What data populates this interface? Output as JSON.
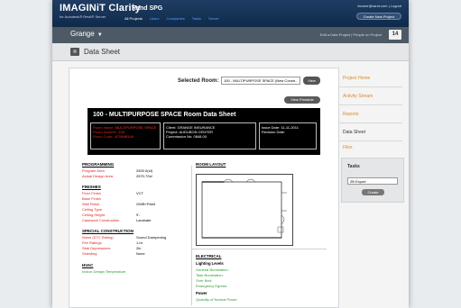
{
  "app": {
    "logo": "IMAGINiT Clarity",
    "logo_sub": "for Autodesk® Revit® Server",
    "project_name": "Rand SPG",
    "nav": [
      "All Projects",
      "Users",
      "Companies",
      "Tasks",
      "Server"
    ],
    "user_email": "ktumer@rand.com | Logout",
    "create_button": "Create New Project"
  },
  "subbar": {
    "project": "Grange",
    "links": "Edit a Data Project | People on Project",
    "count": "14"
  },
  "page": {
    "title": "Data Sheet"
  },
  "selector": {
    "label": "Selected Room:",
    "value": "100 - MULTIPURPOSE SPACE (New Constr...",
    "view_button": "View",
    "printable_button": "View Printable"
  },
  "sheet": {
    "title": "100 - MULTIPURPOSE SPACE Room Data Sheet",
    "room_name_label": "Room Name:",
    "room_name": "MULTIPURPOSE SPACE",
    "room_number_label": "Room Number:",
    "room_number": "100",
    "room_code_label": "Room Code:",
    "room_code": "-679048149",
    "client_label": "Client:",
    "client": "GRANGE INSURANCE",
    "project_label": "Project:",
    "project": "AUDUBON CENTER",
    "commission_label": "Commission No:",
    "commission": "0848.00",
    "issue_label": "Issue Date:",
    "issue": "11-11-2011",
    "revision_label": "Revision Date:",
    "revision": ""
  },
  "programming": {
    "heading": "PROGRAMMING",
    "rows": [
      {
        "label": "Program Area",
        "value": "2500.0(sf)"
      },
      {
        "label": "Actual Design Area",
        "value": "2570.72sf"
      }
    ]
  },
  "finishes": {
    "heading": "FINISHES",
    "rows": [
      {
        "label": "Floor Finish",
        "value": "VCT"
      },
      {
        "label": "Base Finish",
        "value": ""
      },
      {
        "label": "Wall Finish",
        "value": "GWB+Paint"
      },
      {
        "label": "Ceiling Type",
        "value": ""
      },
      {
        "label": "Ceiling Height",
        "value": "9'-"
      },
      {
        "label": "Casework Construction",
        "value": "Laminate"
      }
    ]
  },
  "special": {
    "heading": "SPECIAL CONSTRUCTION",
    "rows": [
      {
        "label": "Noise (STC Rating)",
        "value": "Sound Dampening"
      },
      {
        "label": "Fire Ratings",
        "value": "1-hr"
      },
      {
        "label": "Slab Depressions",
        "value": "2in"
      },
      {
        "label": "Shielding",
        "value": "None"
      }
    ]
  },
  "hvac": {
    "heading": "HVAC",
    "rows": [
      {
        "label": "Indoor Design Temperature",
        "value": ""
      }
    ]
  },
  "layout": {
    "heading": "ROOM LAYOUT"
  },
  "electrical": {
    "heading": "ELECTRICAL",
    "lighting_heading": "Lighting Levels",
    "lighting": [
      "General Illumination:",
      "Task Illumination:",
      "Over Bed:",
      "Emergency Egress:"
    ],
    "power_heading": "Power",
    "power": [
      "Quantity of Normal Power"
    ]
  },
  "sidebar": {
    "links": [
      "Project Home",
      "Activity Stream",
      "Reports",
      "Data Sheet",
      "Files"
    ],
    "tasks_title": "Tasks",
    "tasks_select": "2B Export",
    "tasks_button": "Create"
  }
}
